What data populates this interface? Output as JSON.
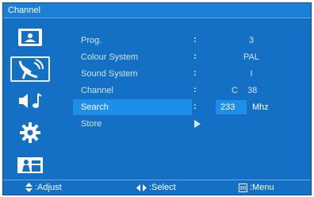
{
  "title": "Channel",
  "menu": [
    {
      "label": "Prog.",
      "value": "3"
    },
    {
      "label": "Colour System",
      "value": "PAL"
    },
    {
      "label": "Sound System",
      "value": "I"
    },
    {
      "label": "Channel",
      "prefix": "C",
      "value": "38"
    },
    {
      "label": "Search",
      "value": "233",
      "unit": "Mhz"
    },
    {
      "label": "Store"
    }
  ],
  "footer": {
    "adjust": ":Adjust",
    "select": ":Select",
    "menu": ":Menu"
  },
  "colors": {
    "panel": "#1470c4",
    "highlight": "#1e8fe8"
  }
}
